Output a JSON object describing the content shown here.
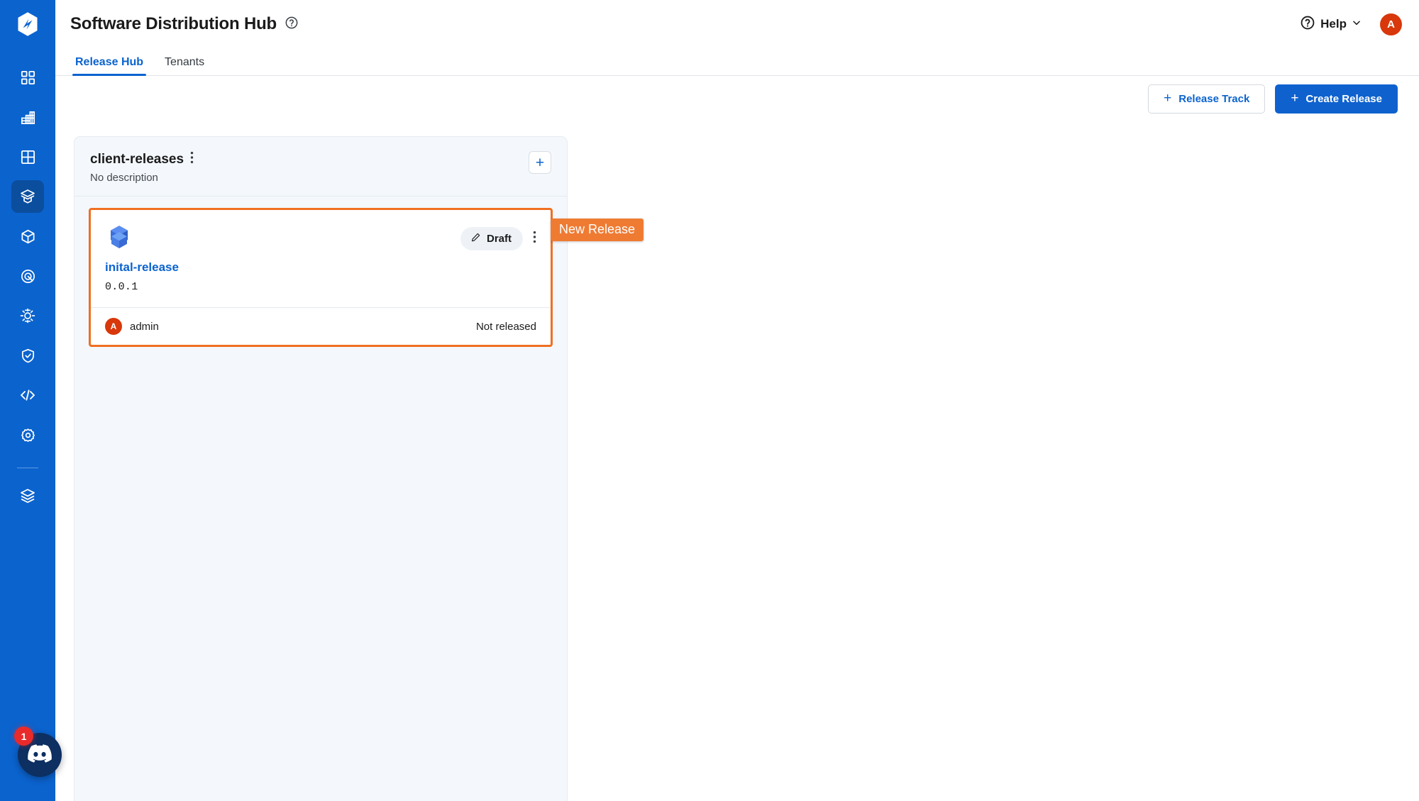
{
  "colors": {
    "sidebar_bg": "#0b63ce",
    "sidebar_active": "#0b4e9e",
    "primary": "#0f62ce",
    "accent_link": "#0b63ce",
    "highlight_orange": "#ef7022",
    "tooltip_orange": "#ef7b33",
    "avatar_red": "#d8380b",
    "badge_red": "#ea2a2a",
    "board_bg": "#f4f8fc",
    "discord_navy": "#0d2f61"
  },
  "sidebar": {
    "logo_name": "app-logo",
    "items": [
      {
        "name": "sidebar-item-dashboard",
        "icon": "grid-squares-icon",
        "active": false
      },
      {
        "name": "sidebar-item-reports",
        "icon": "bar-chart-grid-icon",
        "active": false
      },
      {
        "name": "sidebar-item-tables",
        "icon": "table-grid-icon",
        "active": false
      },
      {
        "name": "sidebar-item-release-hub",
        "icon": "open-box-icon",
        "active": true
      },
      {
        "name": "sidebar-item-packages",
        "icon": "cube-icon",
        "active": false
      },
      {
        "name": "sidebar-item-targets",
        "icon": "target-q-icon",
        "active": false
      },
      {
        "name": "sidebar-item-devices",
        "icon": "sun-gear-icon",
        "active": false
      },
      {
        "name": "sidebar-item-security",
        "icon": "shield-check-icon",
        "active": false
      },
      {
        "name": "sidebar-item-developer",
        "icon": "code-brackets-icon",
        "active": false
      },
      {
        "name": "sidebar-item-settings",
        "icon": "gear-icon",
        "active": false
      },
      {
        "name": "sidebar-item-layers",
        "icon": "layers-stack-icon",
        "active": false
      }
    ],
    "divider_before_index": 10
  },
  "header": {
    "title": "Software Distribution Hub",
    "title_help_icon": "question-circle-icon",
    "help_label": "Help",
    "help_icon": "question-circle-icon",
    "help_chevron_icon": "chevron-down-icon",
    "avatar_initial": "A"
  },
  "tabs": [
    {
      "label": "Release Hub",
      "active": true
    },
    {
      "label": "Tenants",
      "active": false
    }
  ],
  "toolbar": {
    "release_track_label": "Release Track",
    "release_track_plus": "+",
    "create_release_label": "Create Release",
    "create_release_plus": "+"
  },
  "board": {
    "column": {
      "title": "client-releases",
      "description": "No description",
      "kebab_icon": "vertical-dots-icon",
      "add_button_label": "+",
      "add_button_icon": "plus-icon"
    },
    "card": {
      "package_icon": "open-box-3d-icon",
      "status_label": "Draft",
      "status_icon": "pencil-edit-icon",
      "kebab_icon": "vertical-dots-icon",
      "release_name": "inital-release",
      "version": "0.0.1",
      "author_initial": "A",
      "author_name": "admin",
      "release_status": "Not released"
    }
  },
  "tooltip": {
    "new_release_label": "New Release"
  },
  "discord": {
    "icon": "discord-icon",
    "badge_count": "1"
  }
}
